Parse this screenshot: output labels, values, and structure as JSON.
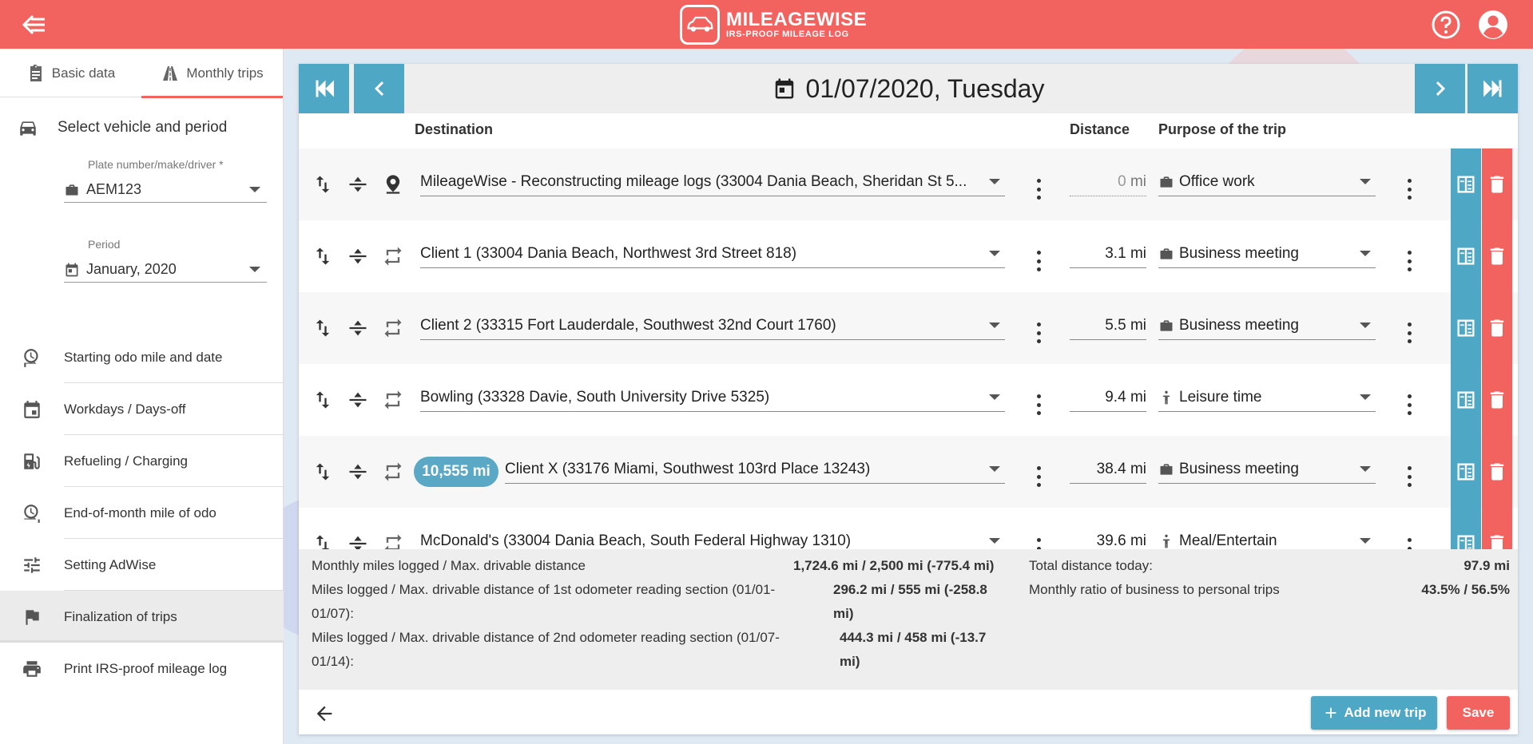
{
  "header": {
    "brand_name": "MILEAGEWISE",
    "brand_tagline": "IRS-PROOF MILEAGE LOG",
    "accent": "#f2635f"
  },
  "sidebar": {
    "tabs": [
      {
        "label": "Basic data",
        "icon": "clipboard-icon"
      },
      {
        "label": "Monthly trips",
        "icon": "road-icon",
        "active": true
      }
    ],
    "section_title": "Select vehicle and period",
    "vehicle_field": {
      "label": "Plate number/make/driver *",
      "value": "AEM123"
    },
    "period_field": {
      "label": "Period",
      "value": "January, 2020"
    },
    "menu": [
      {
        "label": "Starting odo mile and date",
        "icon": "odo-start-icon"
      },
      {
        "label": "Workdays / Days-off",
        "icon": "calendar-icon"
      },
      {
        "label": "Refueling / Charging",
        "icon": "fuel-icon"
      },
      {
        "label": "End-of-month mile of odo",
        "icon": "odo-end-icon"
      },
      {
        "label": "Setting AdWise",
        "icon": "sliders-icon"
      },
      {
        "label": "Finalization of trips",
        "icon": "flag-icon",
        "active": true
      },
      {
        "label": "Print IRS-proof mileage log",
        "icon": "printer-icon"
      }
    ]
  },
  "day": {
    "date_label": "01/07/2020, Tuesday",
    "columns": {
      "destination": "Destination",
      "distance": "Distance",
      "purpose": "Purpose of the trip"
    },
    "trips": [
      {
        "destination": "MileageWise - Reconstructing mileage logs (33004 Dania Beach, Sheridan St 5...",
        "distance": "0",
        "unit": "mi",
        "purpose": "Office work",
        "purpose_icon": "briefcase-icon",
        "first": true
      },
      {
        "destination": "Client 1 (33004 Dania Beach, Northwest 3rd Street 818)",
        "distance": "3.1",
        "unit": "mi",
        "purpose": "Business meeting",
        "purpose_icon": "briefcase-icon"
      },
      {
        "destination": "Client 2 (33315 Fort Lauderdale, Southwest 32nd Court 1760)",
        "distance": "5.5",
        "unit": "mi",
        "purpose": "Business meeting",
        "purpose_icon": "briefcase-icon"
      },
      {
        "destination": "Bowling (33328 Davie, South University Drive 5325)",
        "distance": "9.4",
        "unit": "mi",
        "purpose": "Leisure time",
        "purpose_icon": "person-icon"
      },
      {
        "destination": "Client X (33176 Miami, Southwest 103rd Place 13243)",
        "distance": "38.4",
        "unit": "mi",
        "purpose": "Business meeting",
        "purpose_icon": "briefcase-icon",
        "odo_badge": "10,555 mi"
      },
      {
        "destination": "McDonald's (33004 Dania Beach, South Federal Highway 1310)",
        "distance": "39.6",
        "unit": "mi",
        "purpose": "Meal/Entertain",
        "purpose_icon": "person-icon"
      }
    ]
  },
  "stats": {
    "monthly_label": "Monthly miles logged / Max. drivable distance",
    "monthly_value": "1,724.6 mi / 2,500 mi (-775.4 mi)",
    "section1_label_a": "Miles logged / Max. drivable distance of 1st odometer reading section (01/01-",
    "section1_label_b": "01/07):",
    "section1_value_a": "296.2 mi / 555 mi (-258.8",
    "section1_value_b": "mi)",
    "section2_label_a": "Miles logged / Max. drivable distance of 2nd odometer reading section (01/07-",
    "section2_label_b": "01/14):",
    "section2_value_a": "444.3 mi / 458 mi (-13.7",
    "section2_value_b": "mi)",
    "today_label": "Total distance today:",
    "today_value": "97.9 mi",
    "ratio_label": "Monthly ratio of business to personal trips",
    "ratio_value": "43.5% / 56.5%"
  },
  "footer": {
    "add_label": "Add new trip",
    "save_label": "Save"
  }
}
